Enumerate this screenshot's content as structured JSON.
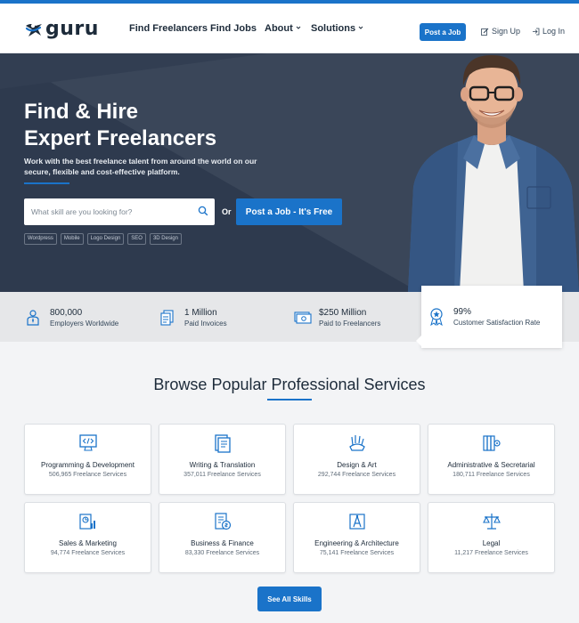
{
  "header": {
    "logo_text": "guru",
    "nav": [
      {
        "label": "Find Freelancers",
        "dropdown": false
      },
      {
        "label": "Find Jobs",
        "dropdown": false
      },
      {
        "label": "About",
        "dropdown": true
      },
      {
        "label": "Solutions",
        "dropdown": true
      }
    ],
    "post_job_label": "Post a Job",
    "sign_up_label": "Sign Up",
    "log_in_label": "Log In"
  },
  "hero": {
    "title_line1": "Find & Hire",
    "title_line2": "Expert Freelancers",
    "subtitle": "Work with the best freelance talent from around the world on our secure, flexible and cost-effective platform.",
    "search_placeholder": "What skill are you looking for?",
    "or_label": "Or",
    "post_job_free_label": "Post a Job - It's Free",
    "tags": [
      "Wordpress",
      "Mobile",
      "Logo Design",
      "SEO",
      "3D Design"
    ]
  },
  "stats": [
    {
      "value": "800,000",
      "label": "Employers Worldwide",
      "icon": "employer-icon"
    },
    {
      "value": "1 Million",
      "label": "Paid Invoices",
      "icon": "invoice-icon"
    },
    {
      "value": "$250 Million",
      "label": "Paid to Freelancers",
      "icon": "money-icon"
    },
    {
      "value": "99%",
      "label": "Customer Satisfaction Rate",
      "icon": "award-badge-icon"
    }
  ],
  "browse": {
    "title": "Browse Popular Professional Services",
    "categories": [
      {
        "name": "Programming & Development",
        "count": "506,965 Freelance Services",
        "icon": "code-monitor-icon"
      },
      {
        "name": "Writing & Translation",
        "count": "357,011 Freelance Services",
        "icon": "document-icon"
      },
      {
        "name": "Design & Art",
        "count": "292,744 Freelance Services",
        "icon": "palette-icon"
      },
      {
        "name": "Administrative & Secretarial",
        "count": "180,711 Freelance Services",
        "icon": "binders-gear-icon"
      },
      {
        "name": "Sales & Marketing",
        "count": "94,774 Freelance Services",
        "icon": "chart-report-icon"
      },
      {
        "name": "Business & Finance",
        "count": "83,330 Freelance Services",
        "icon": "finance-document-icon"
      },
      {
        "name": "Engineering & Architecture",
        "count": "75,141 Freelance Services",
        "icon": "compass-blueprint-icon"
      },
      {
        "name": "Legal",
        "count": "11,217 Freelance Services",
        "icon": "scales-icon"
      }
    ],
    "see_all_label": "See All Skills"
  },
  "colors": {
    "brand_blue": "#1a73c9",
    "hero_background": "#2e3a4e",
    "stats_background": "#e6e7e9"
  }
}
